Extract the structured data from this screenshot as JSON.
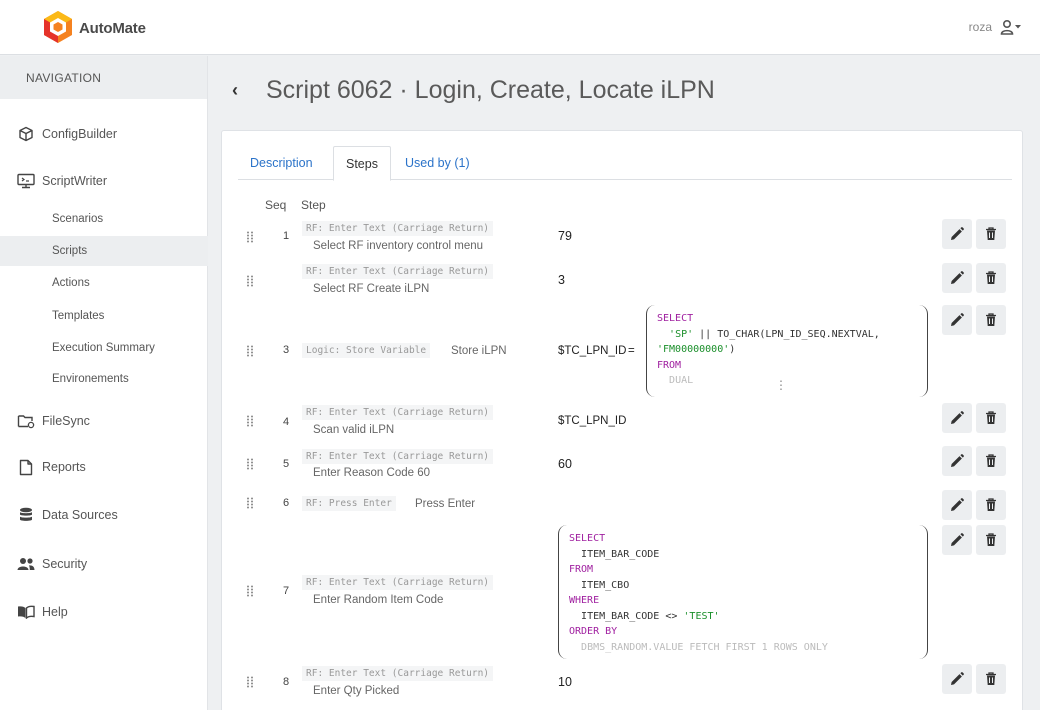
{
  "app": {
    "brand": "AutoMate",
    "user": "roza"
  },
  "navigation": {
    "heading": "NAVIGATION",
    "items": [
      {
        "label": "ConfigBuilder",
        "icon": "cube-icon"
      },
      {
        "label": "ScriptWriter",
        "icon": "monitor-script-icon"
      },
      {
        "label": "FileSync",
        "icon": "folder-sync-icon"
      },
      {
        "label": "Reports",
        "icon": "report-icon"
      },
      {
        "label": "Data Sources",
        "icon": "database-icon"
      },
      {
        "label": "Security",
        "icon": "people-icon"
      },
      {
        "label": "Help",
        "icon": "book-icon"
      }
    ],
    "sub_items": [
      {
        "label": "Scenarios"
      },
      {
        "label": "Scripts",
        "active": true
      },
      {
        "label": "Actions"
      },
      {
        "label": "Templates"
      },
      {
        "label": "Execution Summary"
      },
      {
        "label": "Environements"
      }
    ]
  },
  "page": {
    "back": "‹",
    "title": "Script 6062 · Login, Create, Locate iLPN",
    "tabs": [
      {
        "label": "Description"
      },
      {
        "label": "Steps",
        "active": true
      },
      {
        "label": "Used by (1)"
      }
    ],
    "columns": {
      "seq": "Seq",
      "step": "Step"
    }
  },
  "steps": [
    {
      "seq": "1",
      "action": "RF: Enter Text (Carriage Return)",
      "desc": "Select RF inventory control menu",
      "value": "79"
    },
    {
      "seq": "",
      "action": "RF: Enter Text (Carriage Return)",
      "desc": "Select RF Create iLPN",
      "value": "3"
    },
    {
      "seq": "3",
      "action": "Logic: Store Variable",
      "desc": "Store iLPN",
      "value": "$TC_LPN_ID",
      "op": "=",
      "code": {
        "l1": "SELECT",
        "l2a": "'SP'",
        "l2b": " || TO_CHAR(LPN_ID_SEQ.NEXTVAL,",
        "l3a": "'FM00000000'",
        "l3b": ")",
        "l4": "FROM",
        "l5": "DUAL",
        "more": "⋮"
      }
    },
    {
      "seq": "4",
      "action": "RF: Enter Text (Carriage Return)",
      "desc": "Scan valid iLPN",
      "value": "$TC_LPN_ID"
    },
    {
      "seq": "5",
      "action": "RF: Enter Text (Carriage Return)",
      "desc": "Enter Reason Code 60",
      "value": "60"
    },
    {
      "seq": "6",
      "action": "RF: Press Enter",
      "desc": "Press Enter",
      "value": ""
    },
    {
      "seq": "7",
      "action": "RF: Enter Text (Carriage Return)",
      "desc": "Enter Random Item Code",
      "value": "",
      "code": {
        "l1": "SELECT",
        "l2": "ITEM_BAR_CODE",
        "l3": "FROM",
        "l4": "ITEM_CBO",
        "l5": "WHERE",
        "l6a": "ITEM_BAR_CODE <> ",
        "l6b": "'TEST'",
        "l7": "ORDER BY",
        "l8": "DBMS_RANDOM.VALUE FETCH FIRST 1 ROWS ONLY"
      }
    },
    {
      "seq": "8",
      "action": "RF: Enter Text (Carriage Return)",
      "desc": "Enter Qty Picked",
      "value": "10"
    }
  ],
  "colors": {
    "accent": "#2b73c9",
    "keyword": "#a020a0",
    "string": "#1a8f2a",
    "logo_orange": "#f58220",
    "logo_red": "#e5332a",
    "logo_yellow": "#fbb917"
  }
}
